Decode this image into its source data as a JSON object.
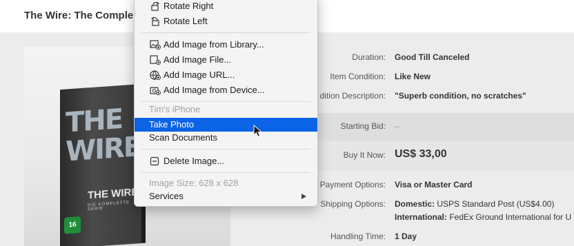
{
  "page": {
    "title": "The Wire: The Comple"
  },
  "product_image": {
    "cover_title": "THE WIRE",
    "cover_title_small": "THE WIRE",
    "cover_subtitle": "DIE KOMPLETTE SERIE",
    "age_rating": "16"
  },
  "details": {
    "duration_label": "Duration:",
    "duration_value": "Good Till Canceled",
    "condition_label": "Item Condition:",
    "condition_value": "Like New",
    "cond_desc_label": "dition Description:",
    "cond_desc_value": "\"Superb condition, no scratches\"",
    "starting_bid_label": "Starting Bid:",
    "starting_bid_value": "–",
    "buy_now_label": "Buy It Now:",
    "buy_now_value": "US$ 33,00",
    "payment_label": "Payment Options:",
    "payment_value": "Visa or Master Card",
    "shipping_label": "Shipping Options:",
    "shipping_domestic_key": "Domestic:",
    "shipping_domestic_value": "USPS Standard Post (US$4.00)",
    "shipping_intl_key": "International:",
    "shipping_intl_value": "FedEx Ground International for U",
    "handling_label": "Handling Time:",
    "handling_value": "1 Day"
  },
  "context_menu": {
    "rotate_right": "Rotate Right",
    "rotate_left": "Rotate Left",
    "add_library": "Add Image from Library...",
    "add_file": "Add Image File...",
    "add_url": "Add Image URL...",
    "add_device": "Add Image from Device...",
    "device_header": "Tim's iPhone",
    "take_photo": "Take Photo",
    "scan_documents": "Scan Documents",
    "delete_image": "Delete Image...",
    "image_size": "Image Size: 628 x 628",
    "services": "Services"
  },
  "colors": {
    "selection": "#0b63e5",
    "disabled_text": "#a0a0a0"
  }
}
